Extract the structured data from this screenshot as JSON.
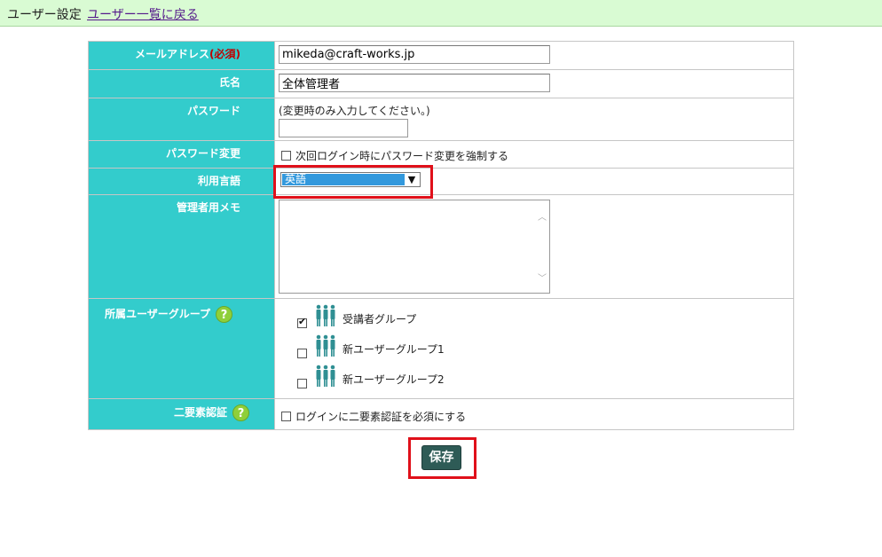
{
  "header": {
    "title": "ユーザー設定",
    "back_link": "ユーザー一覧に戻る"
  },
  "form": {
    "email": {
      "label": "メールアドレス",
      "required": "(必須)",
      "value": "mikeda@craft-works.jp"
    },
    "name": {
      "label": "氏名",
      "value": "全体管理者"
    },
    "password": {
      "label": "パスワード",
      "hint": "(変更時のみ入力してください。)",
      "value": ""
    },
    "password_change": {
      "label": "パスワード変更",
      "checkbox_label": "次回ログイン時にパスワード変更を強制する",
      "checked": false
    },
    "language": {
      "label": "利用言語",
      "selected": "英語"
    },
    "memo": {
      "label": "管理者用メモ",
      "value": ""
    },
    "groups": {
      "label": "所属ユーザーグループ",
      "items": [
        {
          "name": "受講者グループ",
          "checked": true
        },
        {
          "name": "新ユーザーグループ1",
          "checked": false
        },
        {
          "name": "新ユーザーグループ2",
          "checked": false
        }
      ]
    },
    "two_factor": {
      "label": "二要素認証",
      "checkbox_label": "ログインに二要素認証を必須にする",
      "checked": false
    }
  },
  "actions": {
    "save_label": "保存"
  },
  "icons": {
    "help": "help-icon",
    "group": "user-group-icon"
  },
  "colors": {
    "label_bg": "#33cccc",
    "header_bg": "#d9fbd3",
    "save_bg": "#2e5b56",
    "highlight": "#e0101a",
    "select_highlight": "#3399dd"
  }
}
